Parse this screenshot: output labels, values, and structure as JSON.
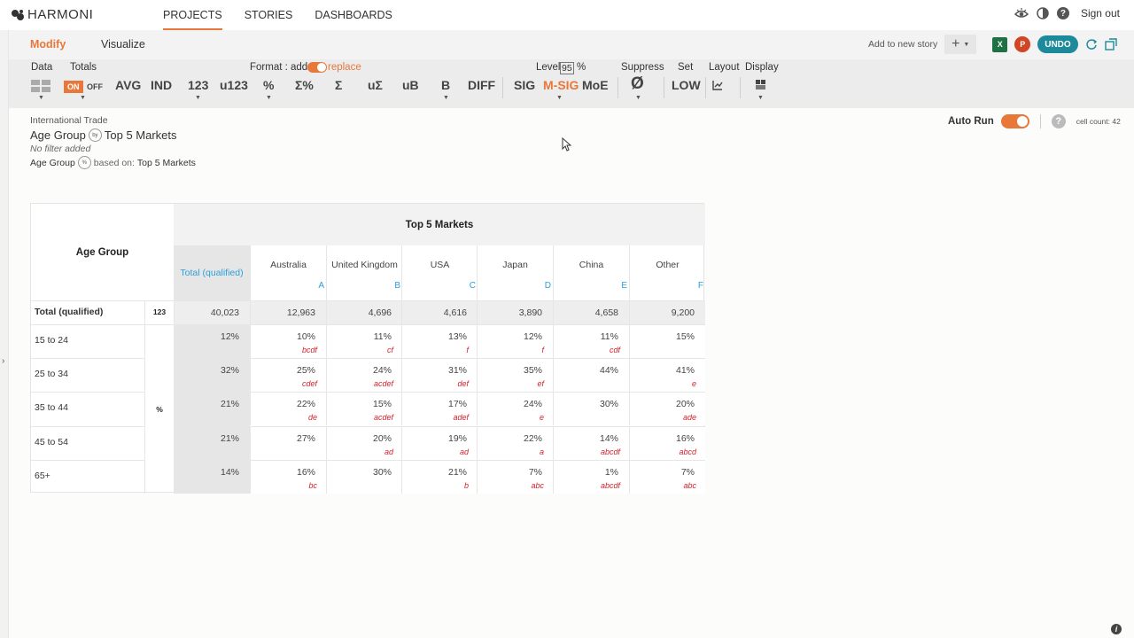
{
  "app": {
    "logo": "HARMONI",
    "nav": [
      "PROJECTS",
      "STORIES",
      "DASHBOARDS"
    ],
    "signout": "Sign out"
  },
  "mode": {
    "modify": "Modify",
    "visualize": "Visualize",
    "add_to_story": "Add to new story",
    "undo": "UNDO"
  },
  "toolbar": {
    "data": "Data",
    "totals": "Totals",
    "on": "ON",
    "off": "OFF",
    "format_label": "Format : add",
    "format_replace": "replace",
    "level_label": "Level",
    "level_value": "95",
    "level_pct": "%",
    "suppress": "Suppress",
    "set": "Set",
    "layout": "Layout",
    "display": "Display",
    "avg": "AVG",
    "ind": "IND",
    "n123": "123",
    "u123": "u123",
    "pct": "%",
    "sigma_pct": "Σ%",
    "sigma": "Σ",
    "u_sigma": "uΣ",
    "ub": "uB",
    "b": "B",
    "diff": "DIFF",
    "sig": "SIG",
    "msig": "M-SIG",
    "moe": "MoE",
    "suppress_sym": "Ø",
    "low": "LOW"
  },
  "report": {
    "title": "International Trade",
    "subtitle_row": "Age Group",
    "subtitle_col": "Top 5 Markets",
    "by": "by",
    "filter": "No filter added",
    "based_row": "Age Group",
    "based_badge": "%",
    "based_on": "based on:",
    "based_col": "Top 5 Markets",
    "auto_run": "Auto Run",
    "cell_count": "cell count: 42"
  },
  "table": {
    "row_header": "Age Group",
    "col_header": "Top 5 Markets",
    "total_col": "Total (qualified)",
    "columns": [
      {
        "name": "Australia",
        "letter": "A"
      },
      {
        "name": "United Kingdom",
        "letter": "B"
      },
      {
        "name": "USA",
        "letter": "C"
      },
      {
        "name": "Japan",
        "letter": "D"
      },
      {
        "name": "China",
        "letter": "E"
      },
      {
        "name": "Other",
        "letter": "F"
      }
    ],
    "total_row": {
      "label": "Total (qualified)",
      "stat": "123",
      "total": "40,023",
      "values": [
        "12,963",
        "4,696",
        "4,616",
        "3,890",
        "4,658",
        "9,200"
      ]
    },
    "pct_stat": "%",
    "rows": [
      {
        "label": "15 to 24",
        "total": "12%",
        "values": [
          "10%",
          "11%",
          "13%",
          "12%",
          "11%",
          "15%"
        ],
        "sig": [
          "bcdf",
          "cf",
          "f",
          "f",
          "cdf",
          ""
        ]
      },
      {
        "label": "25 to 34",
        "total": "32%",
        "values": [
          "25%",
          "24%",
          "31%",
          "35%",
          "44%",
          "41%"
        ],
        "sig": [
          "cdef",
          "acdef",
          "def",
          "ef",
          "",
          "e"
        ]
      },
      {
        "label": "35 to 44",
        "total": "21%",
        "values": [
          "22%",
          "15%",
          "17%",
          "24%",
          "30%",
          "20%"
        ],
        "sig": [
          "de",
          "acdef",
          "adef",
          "e",
          "",
          "ade"
        ]
      },
      {
        "label": "45 to 54",
        "total": "21%",
        "values": [
          "27%",
          "20%",
          "19%",
          "22%",
          "14%",
          "16%"
        ],
        "sig": [
          "",
          "ad",
          "ad",
          "a",
          "abcdf",
          "abcd"
        ]
      },
      {
        "label": "65+",
        "total": "14%",
        "values": [
          "16%",
          "30%",
          "21%",
          "7%",
          "1%",
          "7%"
        ],
        "sig": [
          "bc",
          "",
          "b",
          "abc",
          "abcdf",
          "abc"
        ]
      }
    ]
  },
  "colors": {
    "accent": "#e8773a",
    "teal": "#1c8a9a",
    "sig_red": "#d6202a",
    "letter_blue": "#2c9fd9"
  }
}
